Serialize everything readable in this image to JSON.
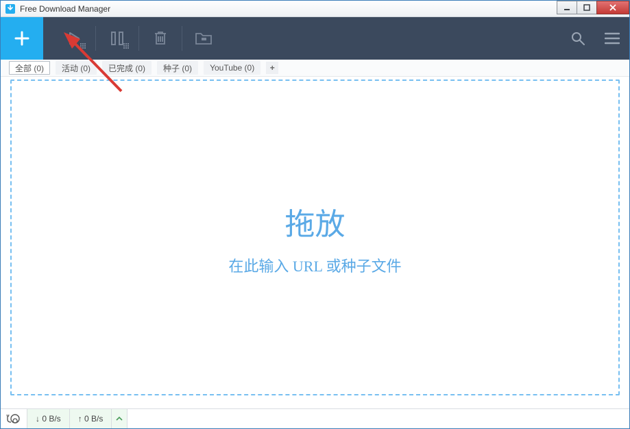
{
  "app": {
    "title": "Free Download Manager"
  },
  "tabs": {
    "items": [
      {
        "label": "全部 (0)",
        "active": true
      },
      {
        "label": "活动 (0)",
        "active": false
      },
      {
        "label": "已完成 (0)",
        "active": false
      },
      {
        "label": "种子 (0)",
        "active": false
      },
      {
        "label": "YouTube (0)",
        "active": false
      }
    ]
  },
  "dropzone": {
    "title": "拖放",
    "subtitle": "在此输入 URL 或种子文件"
  },
  "status": {
    "down_rate": "↓ 0 B/s",
    "up_rate": "↑ 0 B/s"
  },
  "colors": {
    "accent": "#24aef0",
    "toolbar_bg": "#3b495d",
    "dashed_border": "#77bff1",
    "drop_text": "#5aa9e6"
  }
}
